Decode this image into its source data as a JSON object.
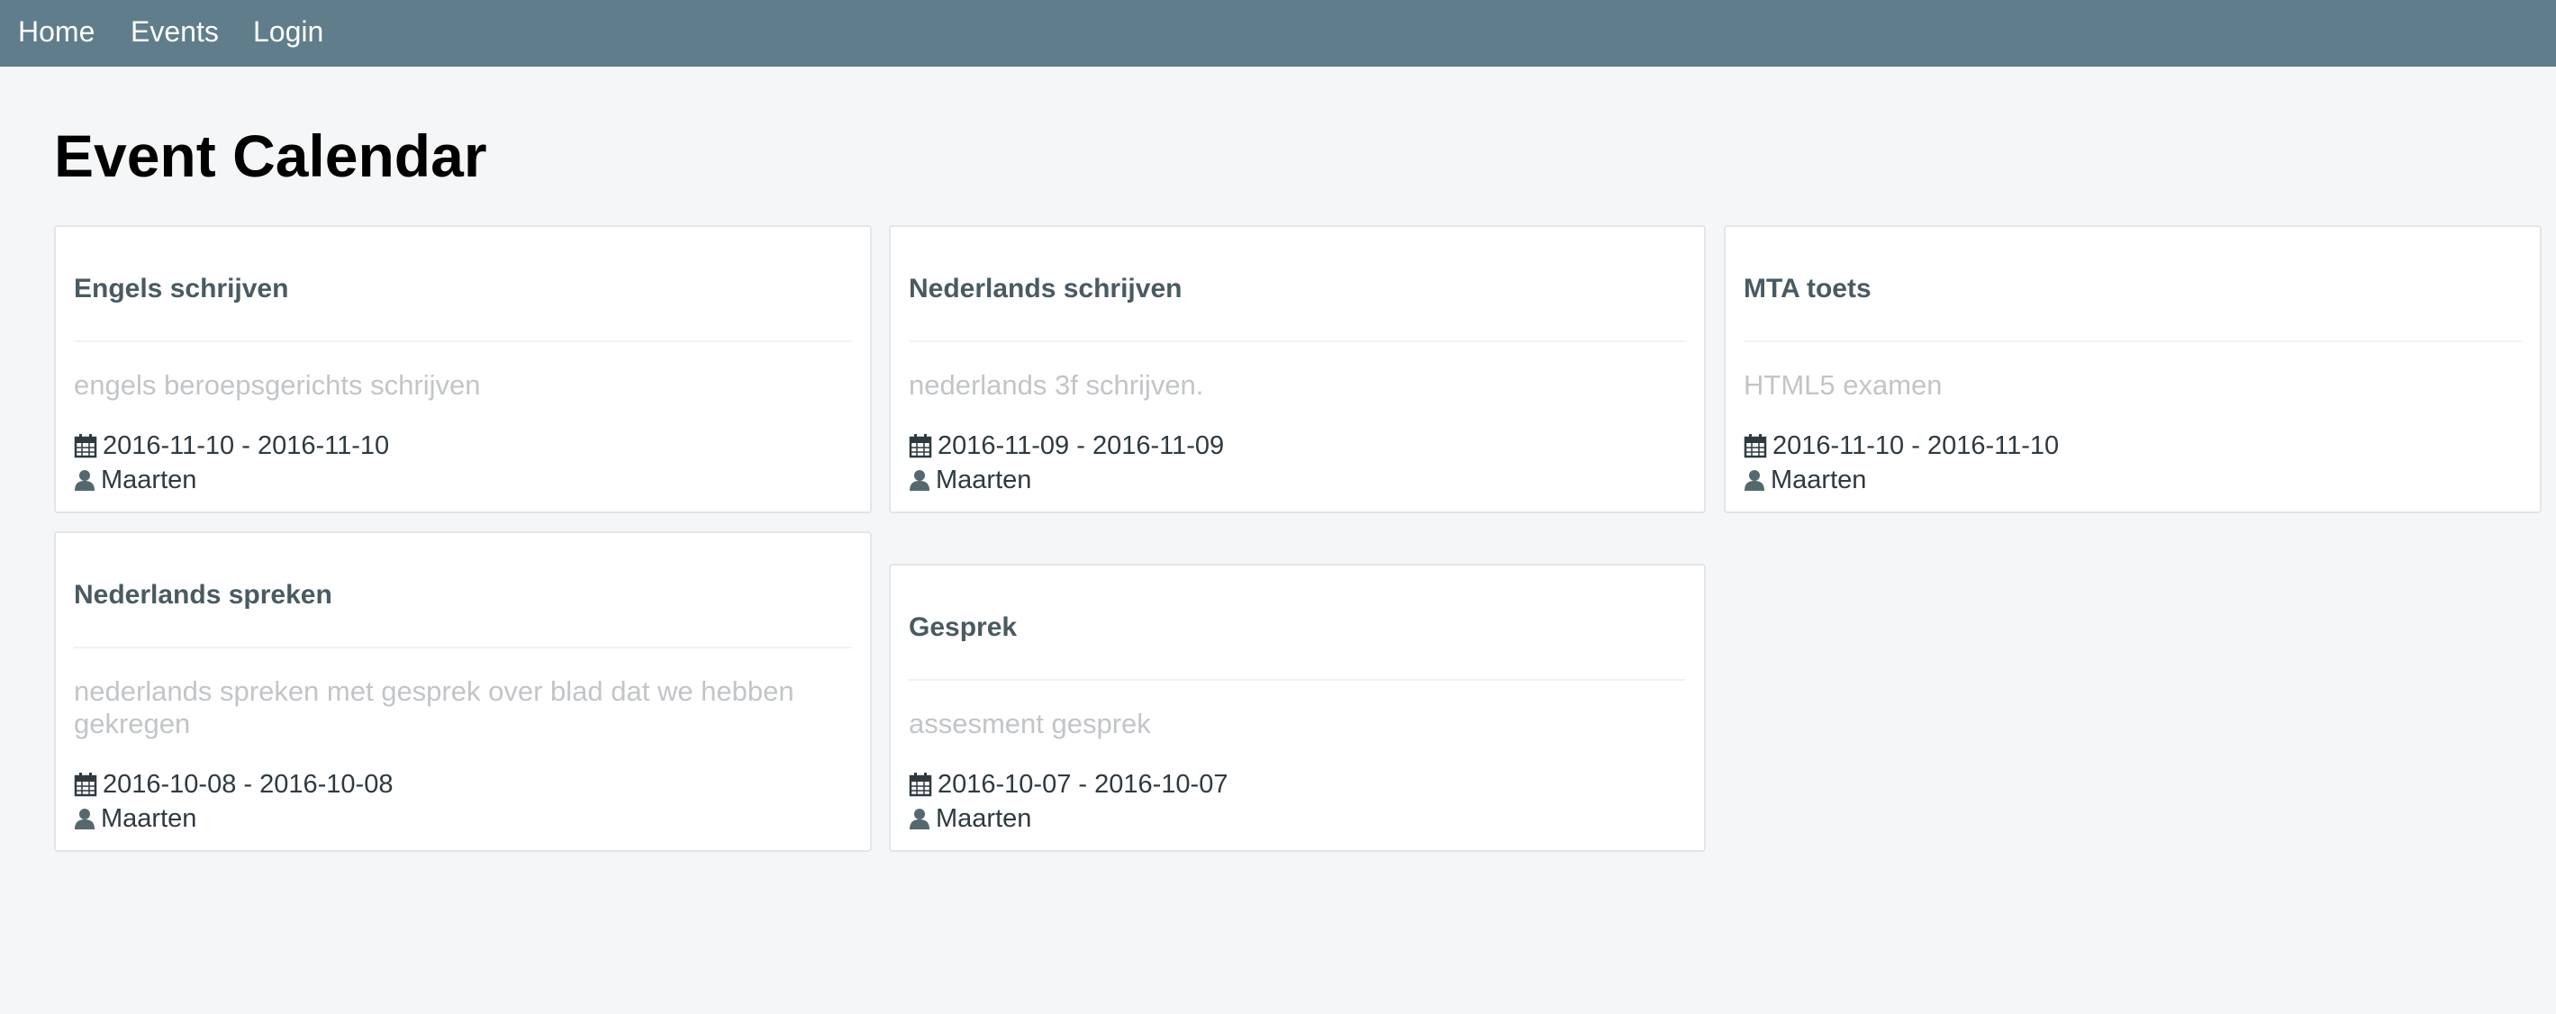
{
  "nav": {
    "home": "Home",
    "events": "Events",
    "login": "Login"
  },
  "page": {
    "title": "Event Calendar"
  },
  "events": [
    {
      "title": "Engels schrijven",
      "description": "engels beroepsgerichts schrijven",
      "dates": "2016-11-10 - 2016-11-10",
      "author": "Maarten"
    },
    {
      "title": "Nederlands schrijven",
      "description": "nederlands 3f schrijven.",
      "dates": "2016-11-09 - 2016-11-09",
      "author": "Maarten"
    },
    {
      "title": "MTA toets",
      "description": "HTML5 examen",
      "dates": "2016-11-10 - 2016-11-10",
      "author": "Maarten"
    },
    {
      "title": "Nederlands spreken",
      "description": "nederlands spreken met gesprek over blad dat we hebben gekregen",
      "dates": "2016-10-08 - 2016-10-08",
      "author": "Maarten"
    },
    {
      "title": "Gesprek",
      "description": "assesment gesprek",
      "dates": "2016-10-07 - 2016-10-07",
      "author": "Maarten"
    }
  ],
  "icons": {
    "date": "calendar-icon",
    "author": "user-icon"
  },
  "colors": {
    "navbar": "#607d8b",
    "card_title": "#4a5a63",
    "description": "#c2c5c8",
    "background": "#f5f6f8"
  }
}
